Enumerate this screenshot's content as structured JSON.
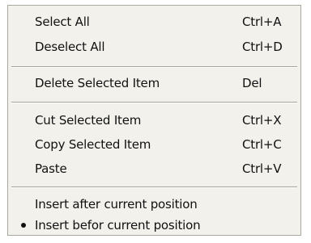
{
  "menu": {
    "items": [
      {
        "label": "Select All",
        "shortcut": "Ctrl+A"
      },
      {
        "label": "Deselect All",
        "shortcut": "Ctrl+D"
      },
      {
        "label": "Delete Selected Item",
        "shortcut": "Del"
      },
      {
        "label": "Cut Selected Item",
        "shortcut": "Ctrl+X"
      },
      {
        "label": "Copy Selected Item",
        "shortcut": "Ctrl+C"
      },
      {
        "label": "Paste",
        "shortcut": "Ctrl+V"
      },
      {
        "label": "Insert after current position",
        "checked": false
      },
      {
        "label": "Insert befor current position",
        "checked": true
      }
    ]
  },
  "colors": {
    "menu_background": "#f2f1ec",
    "menu_border": "#a9a89f",
    "separator": "#a6a59c",
    "text": "#111111"
  }
}
